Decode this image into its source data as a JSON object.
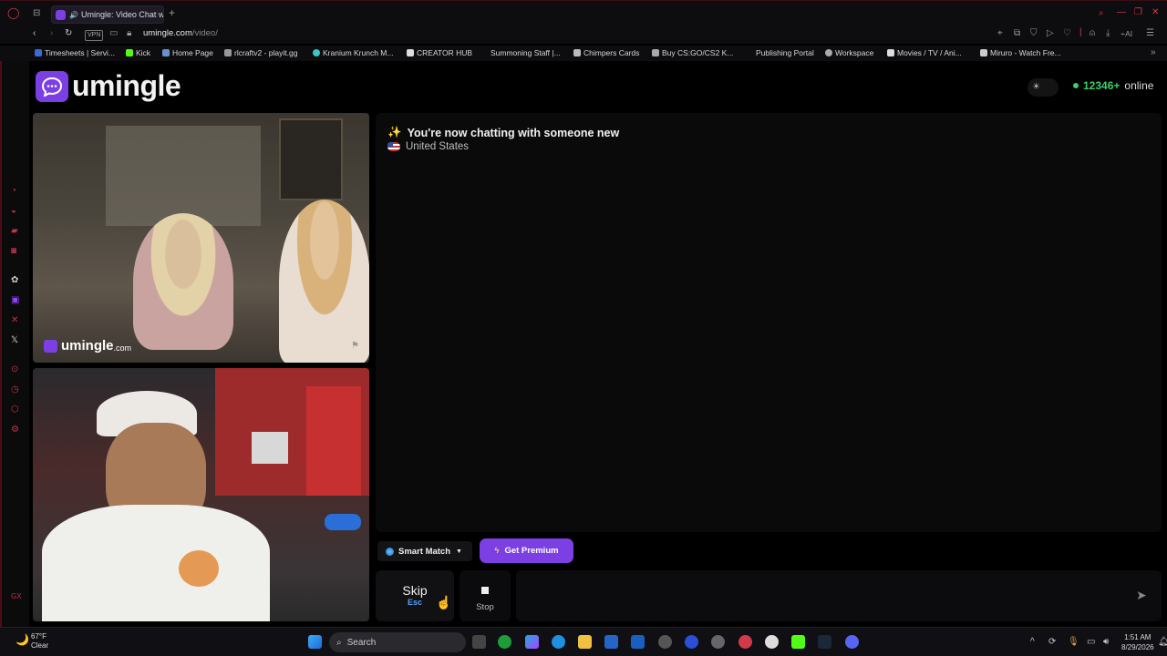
{
  "browser": {
    "tab_title": "Umingle: Video Chat wi",
    "url_domain": "umingle.com",
    "url_path": "/video/",
    "vpn_badge": "VPN",
    "ai_label": "AI",
    "bookmarks": [
      "Timesheets | Servi...",
      "Kick",
      "Home Page",
      "rlcraftv2 - playit.gg",
      "Kranium Krunch M...",
      "CREATOR HUB",
      "Summoning Staff |...",
      "Chimpers Cards",
      "Buy CS:GO/CS2 K...",
      "Publishing Portal",
      "Workspace",
      "Movies / TV / Ani...",
      "Miruro - Watch Fre..."
    ]
  },
  "page": {
    "logo_text": "umingle",
    "online_count": "12346+",
    "online_label": "online",
    "watermark_brand": "umingle",
    "watermark_domain": ".com",
    "chat": {
      "title": "You're now chatting with someone new",
      "title_emoji": "✨",
      "country": "United States"
    },
    "smart_match_label": "Smart Match",
    "premium_label": "Get Premium",
    "skip_label": "Skip",
    "skip_key": "Esc",
    "stop_label": "Stop",
    "message_value": ""
  },
  "taskbar": {
    "weather_temp": "67°F",
    "weather_desc": "Clear",
    "search_label": "Search",
    "time": "1:51 AM",
    "date": "8/29/2026"
  },
  "colors": {
    "accent": "#7b3fe4",
    "online_green": "#3ad16a",
    "key_blue": "#5b9cf5"
  }
}
